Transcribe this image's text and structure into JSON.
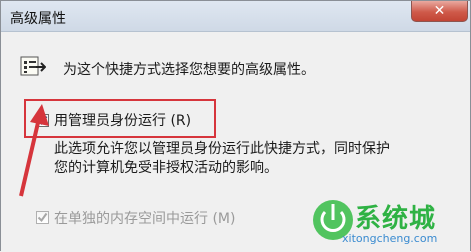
{
  "window": {
    "title": "高级属性",
    "close_glyph": "✕"
  },
  "main": {
    "header_text": "为这个快捷方式选择您想要的高级属性。",
    "run_as_admin_label": "用管理员身份运行 (R)",
    "run_as_admin_checked": true,
    "description_line1": "此选项允许您以管理员身份运行此快捷方式，同时保护",
    "description_line2": "您的计算机免受非授权活动的影响。",
    "separate_memory_label": "在单独的内存空间中运行 (M)",
    "separate_memory_checked": true,
    "separate_memory_enabled": false
  },
  "annotation": {
    "highlight_color": "#d6353c"
  },
  "watermark": {
    "brand_text": "系统城",
    "domain_text": "xitongcheng.com"
  }
}
